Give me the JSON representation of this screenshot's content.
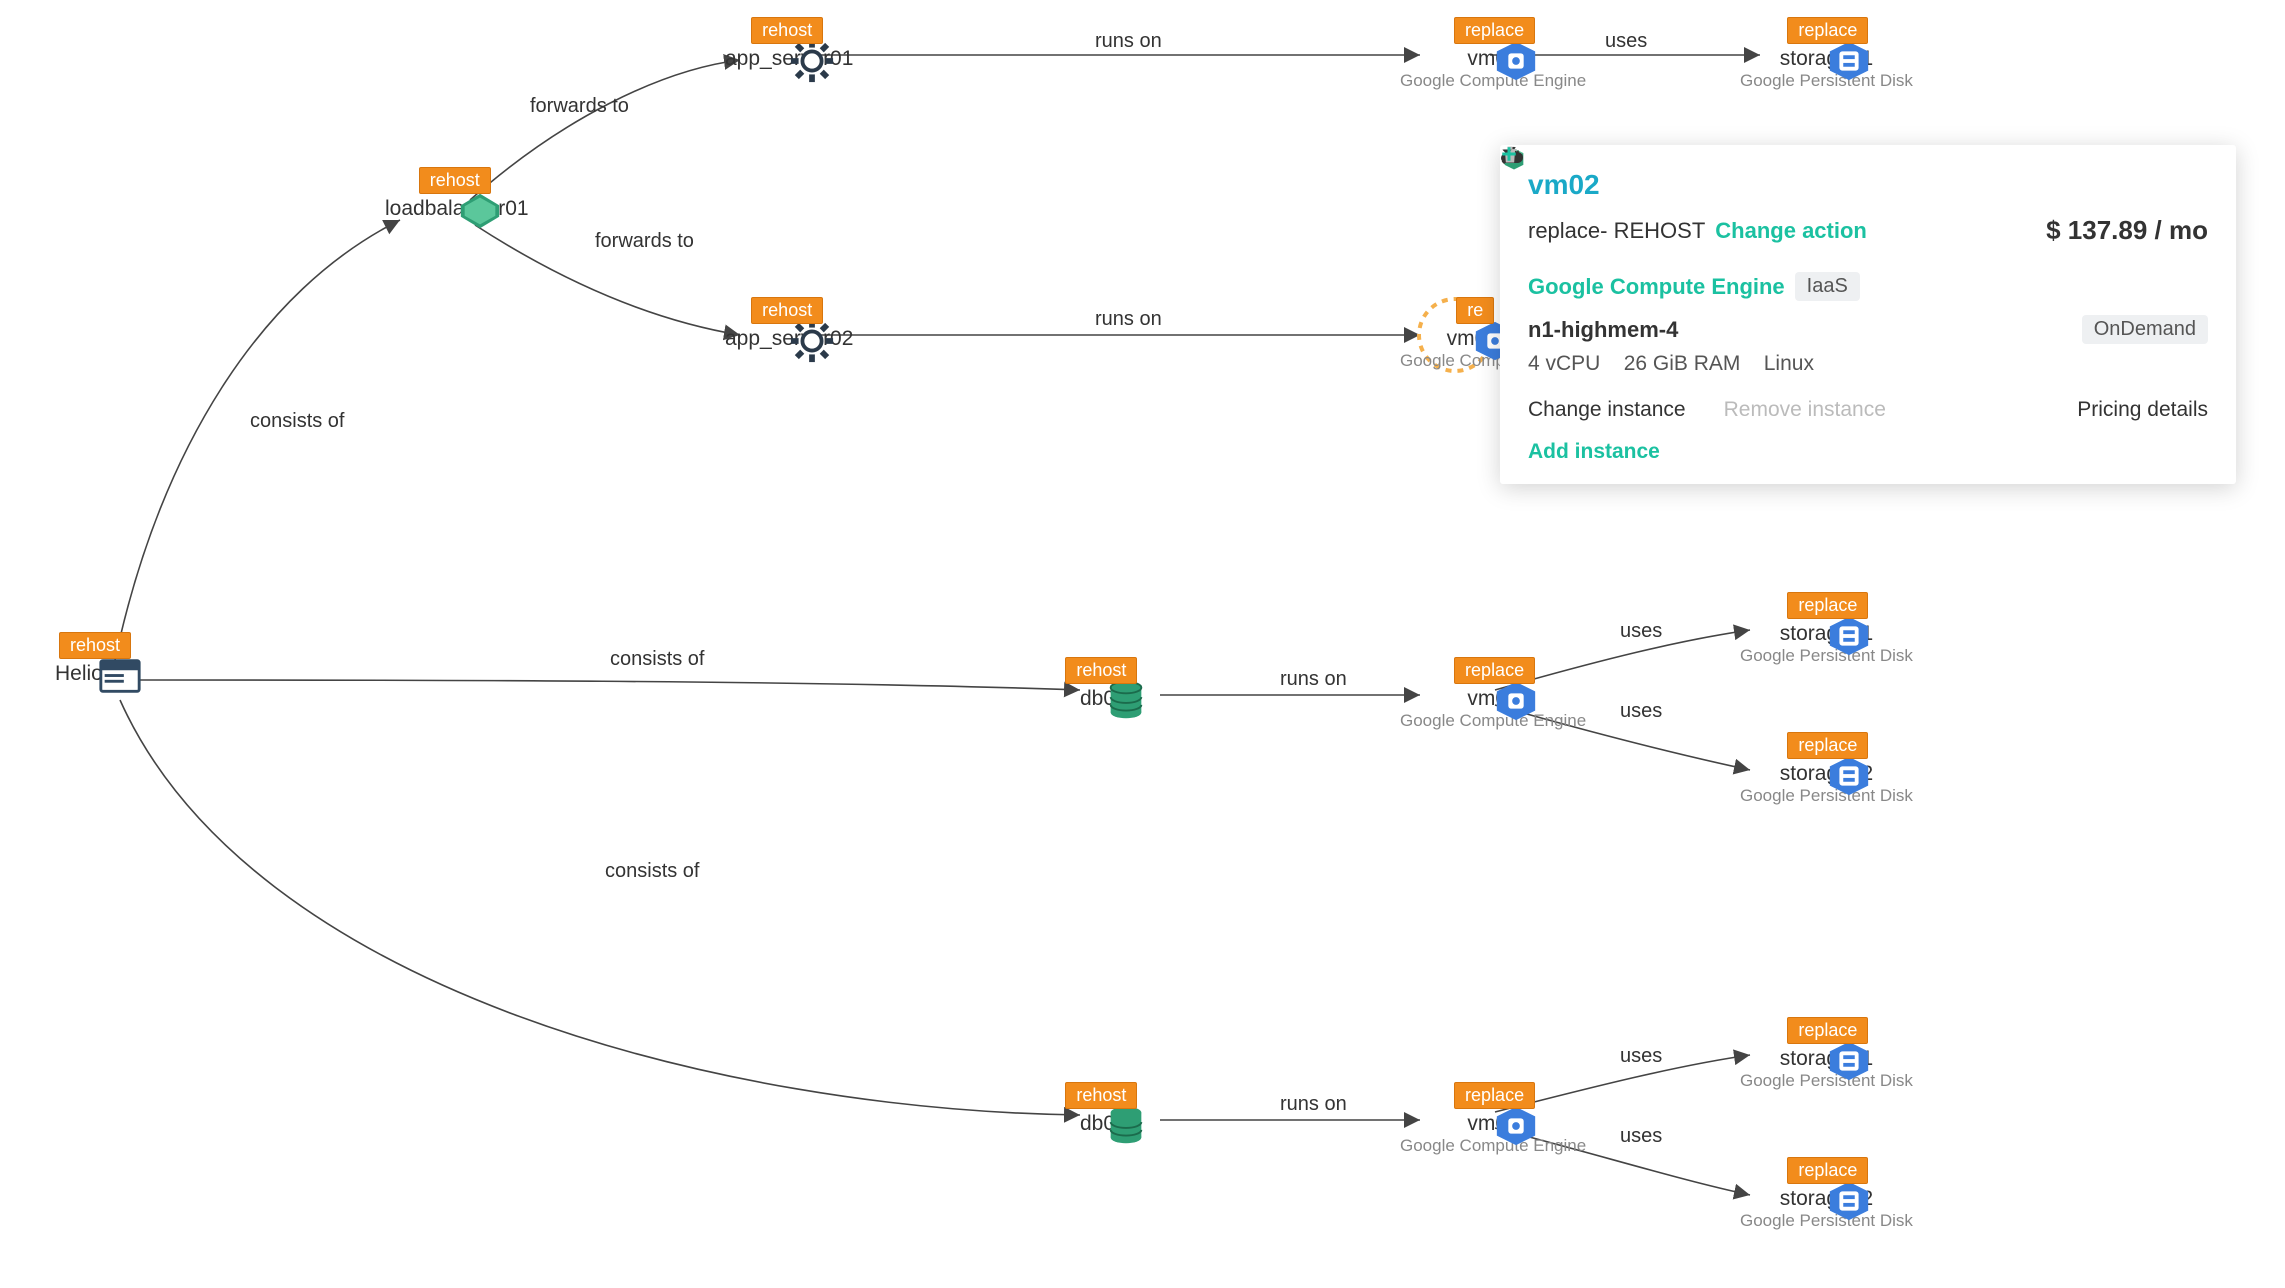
{
  "nodes": {
    "root": {
      "label": "Helios BI",
      "badge": "rehost"
    },
    "lb": {
      "label": "loadbalancer01",
      "badge": "rehost"
    },
    "app1": {
      "label": "app_server01",
      "badge": "rehost"
    },
    "app2": {
      "label": "app_server02",
      "badge": "rehost"
    },
    "db1": {
      "label": "db01",
      "badge": "rehost"
    },
    "db2": {
      "label": "db02",
      "badge": "rehost"
    },
    "vm01": {
      "label": "vm01",
      "sublabel": "Google Compute Engine",
      "badge": "replace"
    },
    "vm02": {
      "label": "vm02",
      "sublabel": "Google Compute E",
      "badge": "re"
    },
    "vm03": {
      "label": "vm03",
      "sublabel": "Google Compute Engine",
      "badge": "replace"
    },
    "vm04": {
      "label": "vm04",
      "sublabel": "Google Compute Engine",
      "badge": "replace"
    },
    "st01a": {
      "label": "storage01",
      "sublabel": "Google Persistent Disk",
      "badge": "replace"
    },
    "st01b": {
      "label": "storage01",
      "sublabel": "Google Persistent Disk",
      "badge": "replace"
    },
    "st02b": {
      "label": "storage02",
      "sublabel": "Google Persistent Disk",
      "badge": "replace"
    },
    "st01c": {
      "label": "storage01",
      "sublabel": "Google Persistent Disk",
      "badge": "replace"
    },
    "st02c": {
      "label": "storage02",
      "sublabel": "Google Persistent Disk",
      "badge": "replace"
    }
  },
  "edges": {
    "e1": "consists of",
    "e2": "forwards to",
    "e3": "forwards to",
    "e4": "runs on",
    "e5": "runs on",
    "e6": "uses",
    "e7": "consists of",
    "e8": "runs on",
    "e9": "uses",
    "e10": "uses",
    "e11": "consists of",
    "e12": "runs on",
    "e13": "uses",
    "e14": "uses"
  },
  "panel": {
    "title": "vm02",
    "action_prefix": "replace- REHOST",
    "change_action": "Change action",
    "price": "$ 137.89 / mo",
    "service": "Google Compute Engine",
    "service_tier": "IaaS",
    "instance": "n1-highmem-4",
    "pricing_model": "OnDemand",
    "spec_cpu": "4 vCPU",
    "spec_ram": "26 GiB RAM",
    "spec_os": "Linux",
    "change_instance": "Change instance",
    "remove_instance": "Remove instance",
    "pricing_details": "Pricing details",
    "add_instance": "Add instance"
  }
}
